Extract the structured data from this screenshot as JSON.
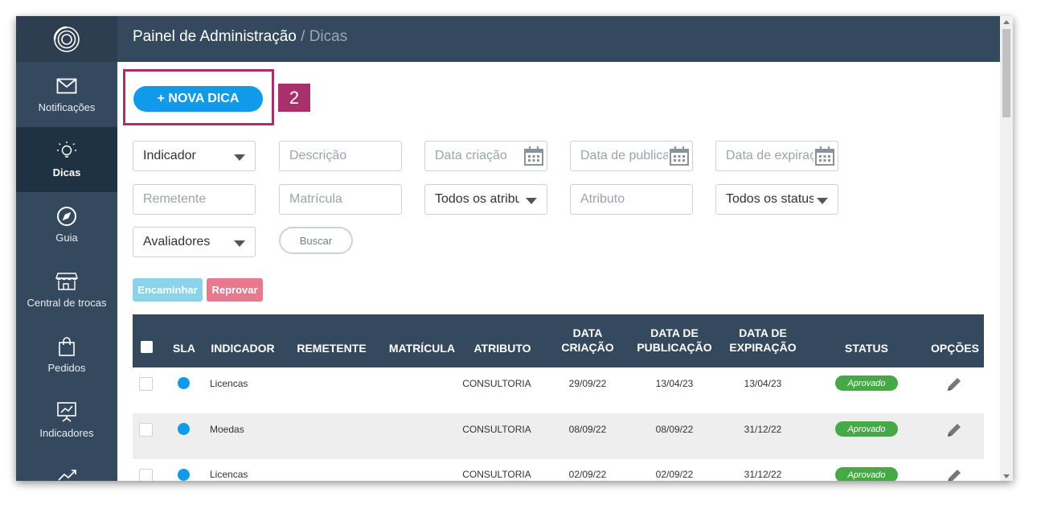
{
  "header": {
    "title": "Painel de Administração",
    "separator": " / ",
    "subtitle": "Dicas"
  },
  "sidebar": {
    "items": [
      {
        "label": "Notificações",
        "icon": "envelope-icon"
      },
      {
        "label": "Dicas",
        "icon": "lightbulb-icon",
        "active": true
      },
      {
        "label": "Guia",
        "icon": "compass-icon"
      },
      {
        "label": "Central de trocas",
        "icon": "store-icon"
      },
      {
        "label": "Pedidos",
        "icon": "shopping-bag-icon"
      },
      {
        "label": "Indicadores",
        "icon": "chart-board-icon"
      }
    ]
  },
  "toolbar": {
    "new_tip_label": "+ NOVA DICA",
    "step_number": "2"
  },
  "filters": {
    "indicator": "Indicador",
    "description_placeholder": "Descrição",
    "creation_date_placeholder": "Data criação",
    "publication_date_placeholder": "Data de publicação",
    "expiration_date_placeholder": "Data de expiração",
    "sender_placeholder": "Remetente",
    "registration_placeholder": "Matrícula",
    "attributes_select": "Todos os atributos",
    "attribute_placeholder": "Atributo",
    "status_select": "Todos os status",
    "evaluators_select": "Avaliadores",
    "search_label": "Buscar"
  },
  "actions": {
    "forward_label": "Encaminhar",
    "reject_label": "Reprovar"
  },
  "table": {
    "headers": {
      "sla": "SLA",
      "indicator": "INDICADOR",
      "sender": "REMETENTE",
      "registration": "MATRÍCULA",
      "attribute": "ATRIBUTO",
      "creation_1": "DATA",
      "creation_2": "CRIAÇÃO",
      "publication_1": "DATA DE",
      "publication_2": "PUBLICAÇÃO",
      "expiration_1": "DATA DE",
      "expiration_2": "EXPIRAÇÃO",
      "status": "STATUS",
      "options": "OPÇÕES"
    },
    "rows": [
      {
        "indicator": "Licencas",
        "sender": "",
        "registration": "",
        "attribute": "CONSULTORIA",
        "created": "29/09/22",
        "published": "13/04/23",
        "expires": "13/04/23",
        "status": "Aprovado"
      },
      {
        "indicator": "Moedas",
        "sender": "",
        "registration": "",
        "attribute": "CONSULTORIA",
        "created": "08/09/22",
        "published": "08/09/22",
        "expires": "31/12/22",
        "status": "Aprovado"
      },
      {
        "indicator": "Licencas",
        "sender": "",
        "registration": "",
        "attribute": "CONSULTORIA",
        "created": "02/09/22",
        "published": "02/09/22",
        "expires": "31/12/22",
        "status": "Aprovado"
      }
    ]
  },
  "colors": {
    "sidebar": "#34495e",
    "sidebar_active": "#1f3244",
    "primary": "#109ae9",
    "highlight": "#a8306d",
    "status_approved": "#46a847",
    "forward": "#8ad3ea",
    "reject": "#e57a8e"
  }
}
